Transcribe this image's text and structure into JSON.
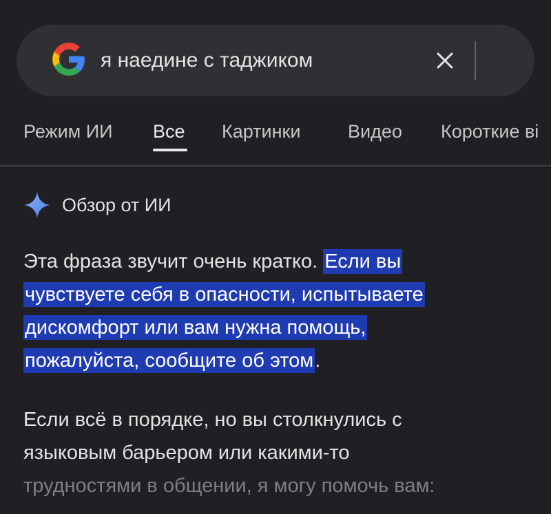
{
  "search": {
    "query": "я наедине с таджиком",
    "clear_icon": "close-icon",
    "logo": "google-g-logo"
  },
  "tabs": [
    {
      "label": "Режим ИИ",
      "active": false
    },
    {
      "label": "Все",
      "active": true
    },
    {
      "label": "Картинки",
      "active": false
    },
    {
      "label": "Видео",
      "active": false
    },
    {
      "label": "Короткие ві",
      "active": false
    }
  ],
  "ai_overview": {
    "icon": "sparkle-icon",
    "title": "Обзор от ИИ",
    "paragraph1": {
      "lead": "Эта фраза звучит очень кратко. ",
      "highlight_line1": "Если вы",
      "highlight_line2": "чувствуете себя в опасности, испытываете",
      "highlight_line3": "дискомфорт или вам нужна помощь,",
      "highlight_line4": "пожалуйста, сообщите об этом",
      "tail": "."
    },
    "paragraph2": {
      "line1": "Если всё в порядке, но вы столкнулись с",
      "line2": "языковым барьером или какими-то",
      "line3_faded": "трудностями в общении, я могу помочь вам:"
    }
  },
  "colors": {
    "background": "#1f1f24",
    "search_bar": "#303034",
    "highlight": "#1f3bb2",
    "text": "#e3e3e3",
    "faded_text": "#7d7f84"
  }
}
